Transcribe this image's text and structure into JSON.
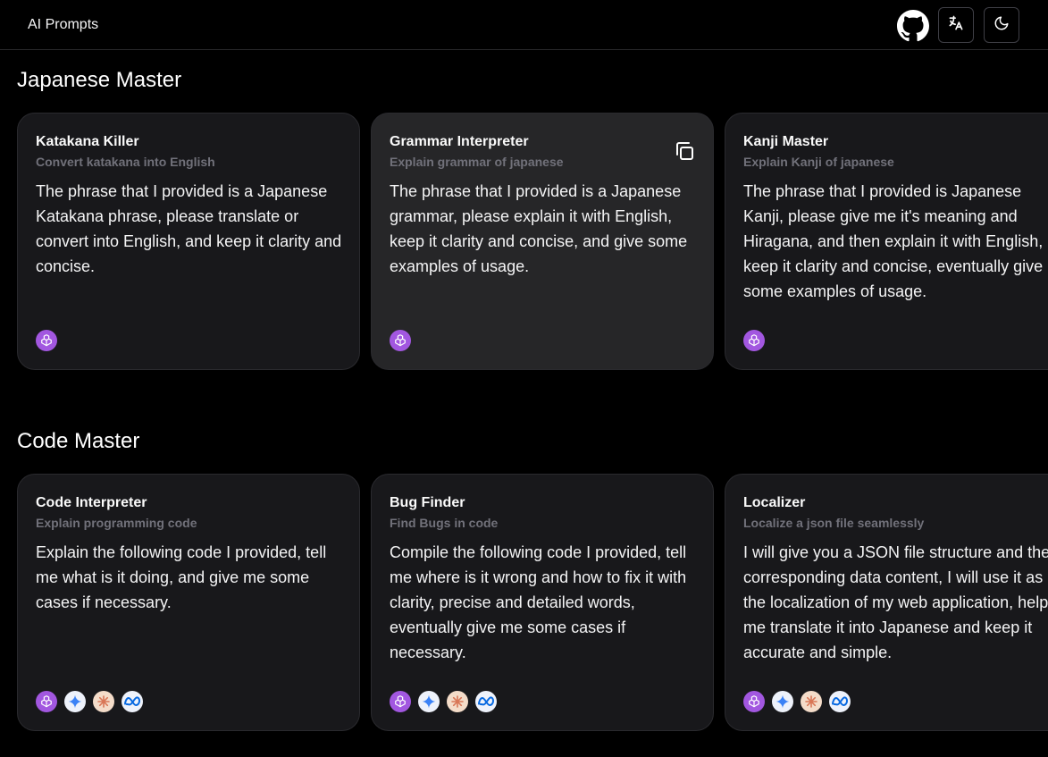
{
  "header": {
    "brand": "AI Prompts",
    "icons": [
      "github-icon",
      "translate-icon",
      "moon-icon"
    ]
  },
  "sections": [
    {
      "title": "Japanese Master",
      "cards": [
        {
          "title": "Katakana Killer",
          "subtitle": "Convert katakana into English",
          "body": "The phrase that I provided is a Japanese Katakana phrase, please translate or convert into English, and keep it clarity and concise.",
          "models": [
            "openai"
          ]
        },
        {
          "title": "Grammar Interpreter",
          "subtitle": "Explain grammar of japanese",
          "body": "The phrase that I provided is a Japanese grammar, please explain it with English, keep it clarity and concise, and give some examples of usage.",
          "models": [
            "openai"
          ]
        },
        {
          "title": "Kanji Master",
          "subtitle": "Explain Kanji of japanese",
          "body": "The phrase that I provided is Japanese Kanji, please give me it's meaning and Hiragana, and then explain it with English, keep it clarity and concise, eventually give some examples of usage.",
          "models": [
            "openai"
          ]
        }
      ]
    },
    {
      "title": "Code Master",
      "cards": [
        {
          "title": "Code Interpreter",
          "subtitle": "Explain programming code",
          "body": "Explain the following code I provided, tell me what is it doing, and give me some cases if necessary.",
          "models": [
            "openai",
            "gemini",
            "claude",
            "meta"
          ]
        },
        {
          "title": "Bug Finder",
          "subtitle": "Find Bugs in code",
          "body": "Compile the following code I provided, tell me where is it wrong and how to fix it with clarity, precise and detailed words, eventually give me some cases if necessary.",
          "models": [
            "openai",
            "gemini",
            "claude",
            "meta"
          ]
        },
        {
          "title": "Localizer",
          "subtitle": "Localize a json file seamlessly",
          "body": "I will give you a JSON file structure and the corresponding data content, I will use it as the localization of my web application, help me translate it into Japanese and keep it accurate and simple.",
          "models": [
            "openai",
            "gemini",
            "claude",
            "meta"
          ]
        }
      ]
    }
  ],
  "colors": {
    "background": "#000000",
    "card": "#18181b",
    "card_hover": "#262628",
    "subtitle": "#71717a",
    "openai": "#a257e0"
  }
}
